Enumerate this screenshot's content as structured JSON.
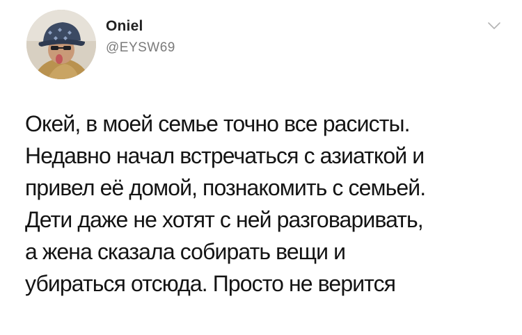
{
  "author": {
    "display_name": "Oniel",
    "handle": "@EYSW69",
    "avatar_icon": "user-avatar-photo"
  },
  "header": {
    "menu_icon": "chevron-down-icon"
  },
  "tweet": {
    "lines": [
      "Окей, в моей семье точно все расисты.",
      "Недавно начал встречаться с азиаткой и",
      "привел её домой, познакомить с семьей.",
      "Дети даже не хотят с ней разговаривать,",
      "а жена сказала собирать вещи и",
      "убираться отсюда. Просто не верится"
    ]
  }
}
